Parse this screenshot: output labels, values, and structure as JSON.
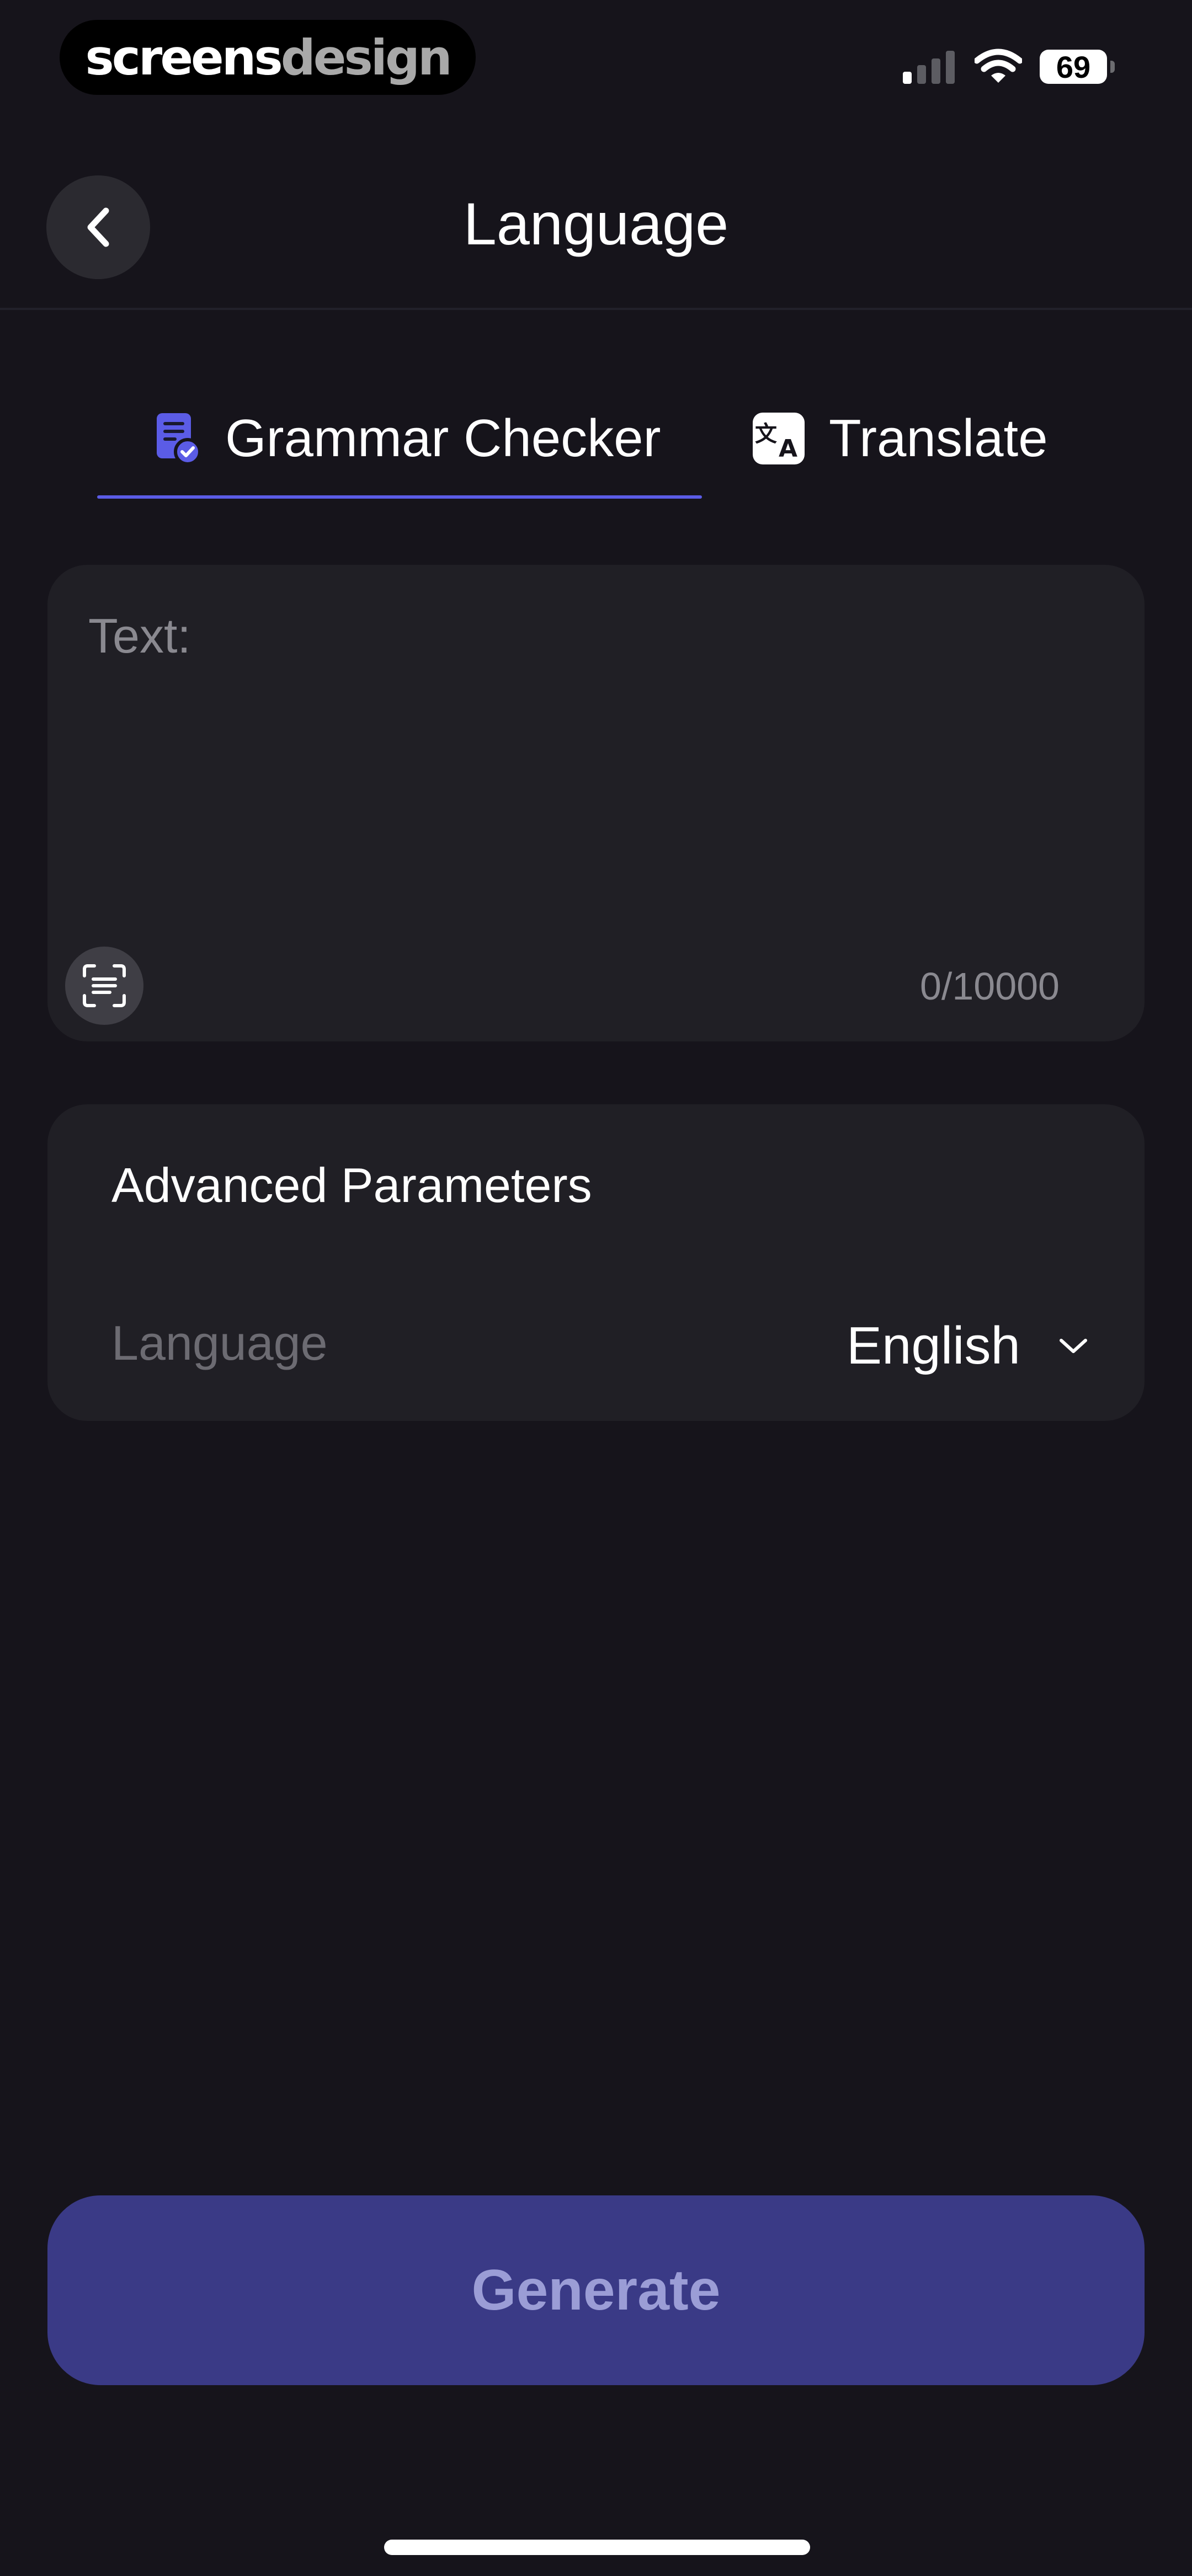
{
  "status_bar": {
    "watermark_part1": "screens",
    "watermark_part2": "design",
    "battery_level": "69",
    "signal_bars_active": 1,
    "signal_bars_total": 4
  },
  "header": {
    "title": "Language",
    "back_icon": "chevron-left-icon"
  },
  "tabs": [
    {
      "label": "Grammar Checker",
      "icon": "grammar-doc-check-icon",
      "active": true
    },
    {
      "label": "Translate",
      "icon": "translate-icon",
      "active": false
    }
  ],
  "text_input": {
    "placeholder": "Text:",
    "value": "",
    "char_count": "0/10000",
    "scan_icon": "text-scan-icon"
  },
  "advanced": {
    "title": "Advanced Parameters",
    "language_label": "Language",
    "language_value": "English",
    "dropdown_icon": "chevron-down-icon"
  },
  "actions": {
    "generate_label": "Generate"
  },
  "colors": {
    "background": "#16141b",
    "card": "#201f25",
    "accent": "#5b5ce6",
    "generate_bg": "#3a3a86",
    "generate_text": "#9b9dd6"
  }
}
